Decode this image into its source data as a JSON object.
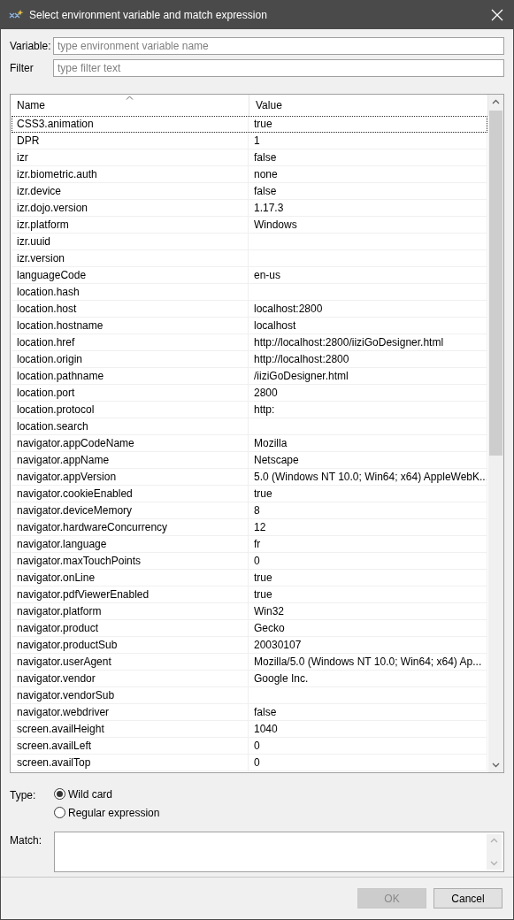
{
  "window": {
    "title": "Select environment variable and match expression"
  },
  "variable": {
    "label": "Variable:",
    "placeholder": "type environment variable name"
  },
  "filter": {
    "label": "Filter",
    "placeholder": "type filter text"
  },
  "table": {
    "columns": [
      "Name",
      "Value"
    ],
    "rows": [
      {
        "name": "CSS3.animation",
        "value": "true",
        "focused": true
      },
      {
        "name": "DPR",
        "value": "1",
        "focused": false
      },
      {
        "name": "izr",
        "value": "false",
        "focused": false
      },
      {
        "name": "izr.biometric.auth",
        "value": "none",
        "focused": false
      },
      {
        "name": "izr.device",
        "value": "false",
        "focused": false
      },
      {
        "name": "izr.dojo.version",
        "value": "1.17.3",
        "focused": false
      },
      {
        "name": "izr.platform",
        "value": "Windows",
        "focused": false
      },
      {
        "name": "izr.uuid",
        "value": "",
        "focused": false
      },
      {
        "name": "izr.version",
        "value": "",
        "focused": false
      },
      {
        "name": "languageCode",
        "value": "en-us",
        "focused": false
      },
      {
        "name": "location.hash",
        "value": "",
        "focused": false
      },
      {
        "name": "location.host",
        "value": "localhost:2800",
        "focused": false
      },
      {
        "name": "location.hostname",
        "value": "localhost",
        "focused": false
      },
      {
        "name": "location.href",
        "value": "http://localhost:2800/iiziGoDesigner.html",
        "focused": false
      },
      {
        "name": "location.origin",
        "value": "http://localhost:2800",
        "focused": false
      },
      {
        "name": "location.pathname",
        "value": "/iiziGoDesigner.html",
        "focused": false
      },
      {
        "name": "location.port",
        "value": "2800",
        "focused": false
      },
      {
        "name": "location.protocol",
        "value": "http:",
        "focused": false
      },
      {
        "name": "location.search",
        "value": "",
        "focused": false
      },
      {
        "name": "navigator.appCodeName",
        "value": "Mozilla",
        "focused": false
      },
      {
        "name": "navigator.appName",
        "value": "Netscape",
        "focused": false
      },
      {
        "name": "navigator.appVersion",
        "value": "5.0 (Windows NT 10.0; Win64; x64) AppleWebK...",
        "focused": false
      },
      {
        "name": "navigator.cookieEnabled",
        "value": "true",
        "focused": false
      },
      {
        "name": "navigator.deviceMemory",
        "value": "8",
        "focused": false
      },
      {
        "name": "navigator.hardwareConcurrency",
        "value": "12",
        "focused": false
      },
      {
        "name": "navigator.language",
        "value": "fr",
        "focused": false
      },
      {
        "name": "navigator.maxTouchPoints",
        "value": "0",
        "focused": false
      },
      {
        "name": "navigator.onLine",
        "value": "true",
        "focused": false
      },
      {
        "name": "navigator.pdfViewerEnabled",
        "value": "true",
        "focused": false
      },
      {
        "name": "navigator.platform",
        "value": "Win32",
        "focused": false
      },
      {
        "name": "navigator.product",
        "value": "Gecko",
        "focused": false
      },
      {
        "name": "navigator.productSub",
        "value": "20030107",
        "focused": false
      },
      {
        "name": "navigator.userAgent",
        "value": "Mozilla/5.0 (Windows NT 10.0; Win64; x64) Ap...",
        "focused": false
      },
      {
        "name": "navigator.vendor",
        "value": "Google Inc.",
        "focused": false
      },
      {
        "name": "navigator.vendorSub",
        "value": "",
        "focused": false
      },
      {
        "name": "navigator.webdriver",
        "value": "false",
        "focused": false
      },
      {
        "name": "screen.availHeight",
        "value": "1040",
        "focused": false
      },
      {
        "name": "screen.availLeft",
        "value": "0",
        "focused": false
      },
      {
        "name": "screen.availTop",
        "value": "0",
        "focused": false
      }
    ]
  },
  "type": {
    "label": "Type:",
    "options": [
      {
        "label": "Wild card",
        "selected": true
      },
      {
        "label": "Regular expression",
        "selected": false
      }
    ]
  },
  "match": {
    "label": "Match:"
  },
  "buttons": [
    {
      "label": "OK",
      "disabled": true
    },
    {
      "label": "Cancel",
      "disabled": false
    }
  ]
}
